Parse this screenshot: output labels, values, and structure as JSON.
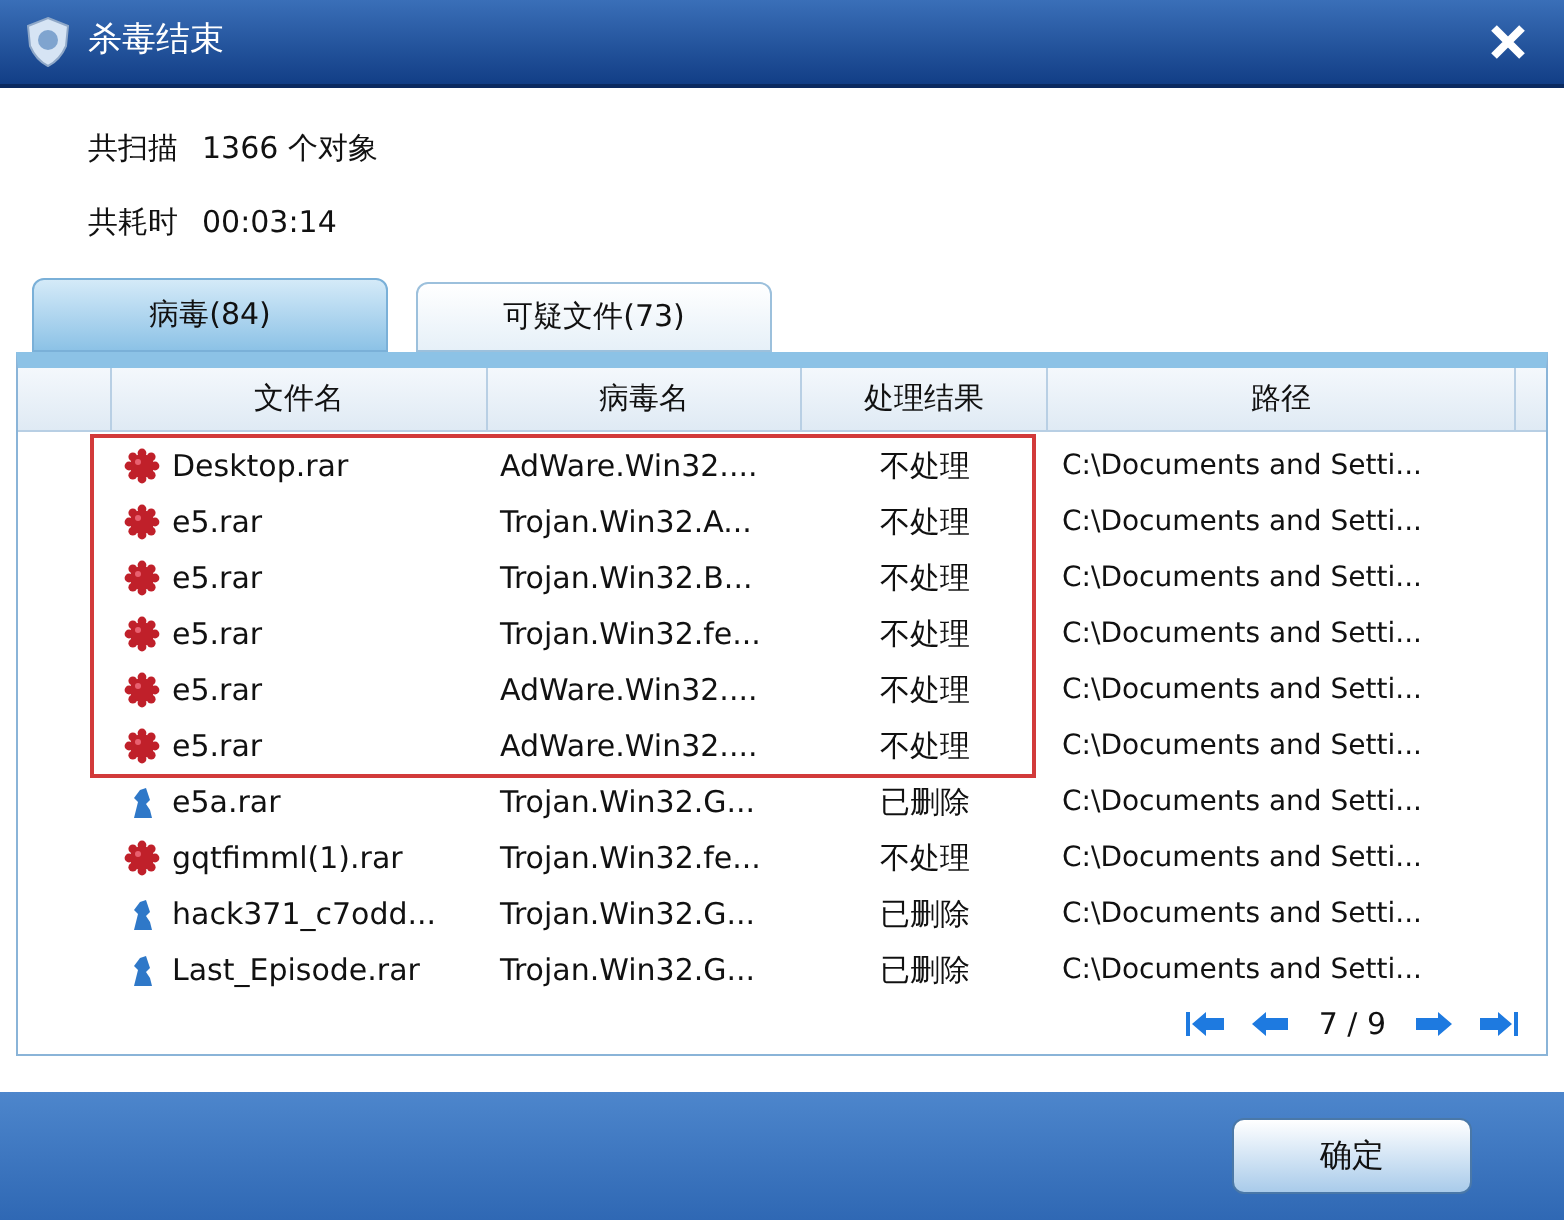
{
  "window": {
    "title": "杀毒结束"
  },
  "summary": [
    {
      "label": "共扫描",
      "value": "1366 个对象"
    },
    {
      "label": "共耗时",
      "value": "00:03:14"
    }
  ],
  "tabs": [
    {
      "label": "病毒(84)",
      "selected": true
    },
    {
      "label": "可疑文件(73)",
      "selected": false
    }
  ],
  "table": {
    "columns": [
      "文件名",
      "病毒名",
      "处理结果",
      "路径"
    ],
    "rows": [
      {
        "kind": "virus",
        "highlighted": true,
        "cells": [
          "Desktop.rar",
          "AdWare.Win32....",
          "不处理",
          "C:\\Documents and Setti..."
        ]
      },
      {
        "kind": "virus",
        "highlighted": true,
        "cells": [
          "e5.rar",
          "Trojan.Win32.A...",
          "不处理",
          "C:\\Documents and Setti..."
        ]
      },
      {
        "kind": "virus",
        "highlighted": true,
        "cells": [
          "e5.rar",
          "Trojan.Win32.B...",
          "不处理",
          "C:\\Documents and Setti..."
        ]
      },
      {
        "kind": "virus",
        "highlighted": true,
        "cells": [
          "e5.rar",
          "Trojan.Win32.fe...",
          "不处理",
          "C:\\Documents and Setti..."
        ]
      },
      {
        "kind": "virus",
        "highlighted": true,
        "cells": [
          "e5.rar",
          "AdWare.Win32....",
          "不处理",
          "C:\\Documents and Setti..."
        ]
      },
      {
        "kind": "virus",
        "highlighted": true,
        "cells": [
          "e5.rar",
          "AdWare.Win32....",
          "不处理",
          "C:\\Documents and Setti..."
        ]
      },
      {
        "kind": "trojan",
        "highlighted": false,
        "cells": [
          "e5a.rar",
          "Trojan.Win32.G...",
          "已删除",
          "C:\\Documents and Setti..."
        ]
      },
      {
        "kind": "virus",
        "highlighted": false,
        "cells": [
          "gqtfimml(1).rar",
          "Trojan.Win32.fe...",
          "不处理",
          "C:\\Documents and Setti..."
        ]
      },
      {
        "kind": "trojan",
        "highlighted": false,
        "cells": [
          "hack371_c7odd...",
          "Trojan.Win32.G...",
          "已删除",
          "C:\\Documents and Setti..."
        ]
      },
      {
        "kind": "trojan",
        "highlighted": false,
        "cells": [
          "Last_Episode.rar",
          "Trojan.Win32.G...",
          "已删除",
          "C:\\Documents and Setti..."
        ]
      }
    ]
  },
  "pagination": {
    "page": "7 / 9"
  },
  "buttons": [
    "确定"
  ]
}
